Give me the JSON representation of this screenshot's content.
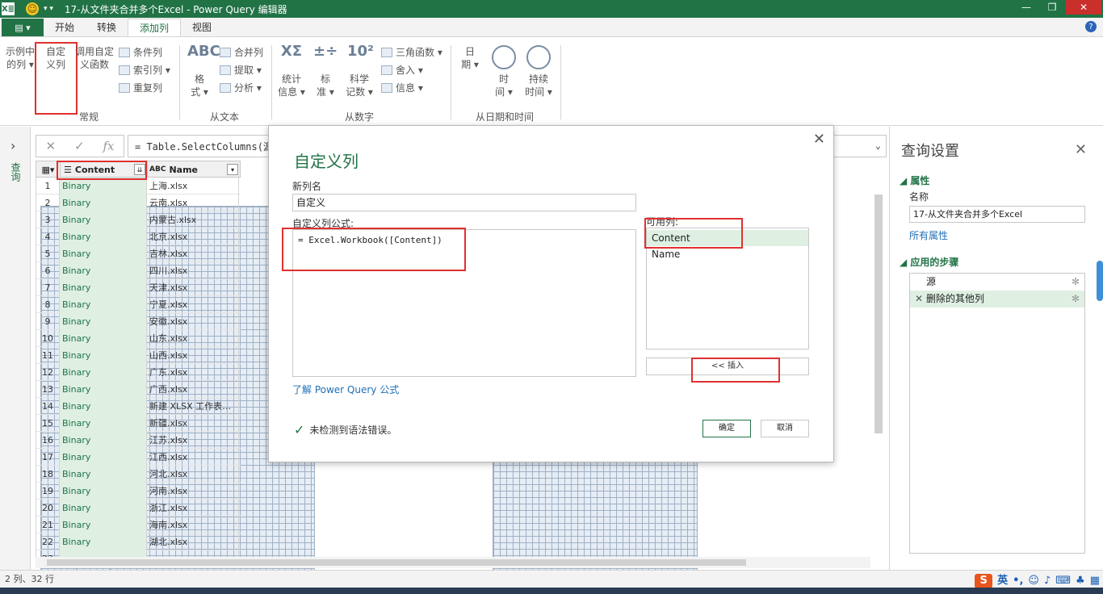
{
  "window": {
    "title": "17-从文件夹合并多个Excel - Power Query 编辑器",
    "app_icon": "X≣",
    "accent": "#217346"
  },
  "tabs": {
    "file": "▤ ▾",
    "items": [
      "开始",
      "转换",
      "添加列",
      "视图"
    ],
    "active": "添加列"
  },
  "ribbon": {
    "general": {
      "example_col": "示例中\n的列 ▾",
      "custom_col": "自定\n义列",
      "invoke_fn": "调用自定\n义函数",
      "conditional": "条件列",
      "index": "索引列 ▾",
      "duplicate": "重复列",
      "label": "常规"
    },
    "text": {
      "format": "格\n式 ▾",
      "merge": "合并列",
      "extract": "提取 ▾",
      "parse": "分析 ▾",
      "label": "从文本"
    },
    "number": {
      "stats": "统计\n信息 ▾",
      "standard": "标\n准 ▾",
      "scientific": "科学\n记数 ▾",
      "trig": "三角函数 ▾",
      "round": "舍入 ▾",
      "info": "信息 ▾",
      "label": "从数字"
    },
    "datetime": {
      "date": "日\n期 ▾",
      "time": "时\n间 ▾",
      "duration": "持续\n时间 ▾",
      "label": "从日期和时间"
    }
  },
  "left_nav": {
    "label": "查询"
  },
  "formula_bar": {
    "formula": "= Table.SelectColumns(源,"
  },
  "grid": {
    "columns": [
      {
        "name": "Content",
        "type_icon": "☰"
      },
      {
        "name": "Name",
        "type_icon": "ABC"
      }
    ],
    "rows": [
      {
        "n": "1",
        "content": "Binary",
        "name": "上海.xlsx"
      },
      {
        "n": "2",
        "content": "Binary",
        "name": "云南.xlsx"
      },
      {
        "n": "3",
        "content": "Binary",
        "name": "内蒙古.xlsx"
      },
      {
        "n": "4",
        "content": "Binary",
        "name": "北京.xlsx"
      },
      {
        "n": "5",
        "content": "Binary",
        "name": "吉林.xlsx"
      },
      {
        "n": "6",
        "content": "Binary",
        "name": "四川.xlsx"
      },
      {
        "n": "7",
        "content": "Binary",
        "name": "天津.xlsx"
      },
      {
        "n": "8",
        "content": "Binary",
        "name": "宁夏.xlsx"
      },
      {
        "n": "9",
        "content": "Binary",
        "name": "安徽.xlsx"
      },
      {
        "n": "10",
        "content": "Binary",
        "name": "山东.xlsx"
      },
      {
        "n": "11",
        "content": "Binary",
        "name": "山西.xlsx"
      },
      {
        "n": "12",
        "content": "Binary",
        "name": "广东.xlsx"
      },
      {
        "n": "13",
        "content": "Binary",
        "name": "广西.xlsx"
      },
      {
        "n": "14",
        "content": "Binary",
        "name": "新建 XLSX 工作表…"
      },
      {
        "n": "15",
        "content": "Binary",
        "name": "新疆.xlsx"
      },
      {
        "n": "16",
        "content": "Binary",
        "name": "江苏.xlsx"
      },
      {
        "n": "17",
        "content": "Binary",
        "name": "江西.xlsx"
      },
      {
        "n": "18",
        "content": "Binary",
        "name": "河北.xlsx"
      },
      {
        "n": "19",
        "content": "Binary",
        "name": "河南.xlsx"
      },
      {
        "n": "20",
        "content": "Binary",
        "name": "浙江.xlsx"
      },
      {
        "n": "21",
        "content": "Binary",
        "name": "海南.xlsx"
      },
      {
        "n": "22",
        "content": "Binary",
        "name": "湖北.xlsx"
      },
      {
        "n": "23",
        "content": "",
        "name": ""
      }
    ]
  },
  "status": {
    "text": "2 列、32 行",
    "ime_lang": "英"
  },
  "query_settings": {
    "title": "查询设置",
    "props_section": "属性",
    "name_label": "名称",
    "name_value": "17-从文件夹合并多个Excel",
    "all_props": "所有属性",
    "steps_section": "应用的步骤",
    "steps": [
      "源",
      "删除的其他列"
    ]
  },
  "dialog": {
    "title": "自定义列",
    "new_col_label": "新列名",
    "new_col_value": "自定义",
    "formula_label": "自定义列公式:",
    "formula_value": "= Excel.Workbook([Content])",
    "available_label": "可用列:",
    "available_cols": [
      "Content",
      "Name"
    ],
    "insert_label": "<< 插入",
    "learn_link": "了解 Power Query 公式",
    "status": "未检测到语法错误。",
    "ok": "确定",
    "cancel": "取消"
  }
}
